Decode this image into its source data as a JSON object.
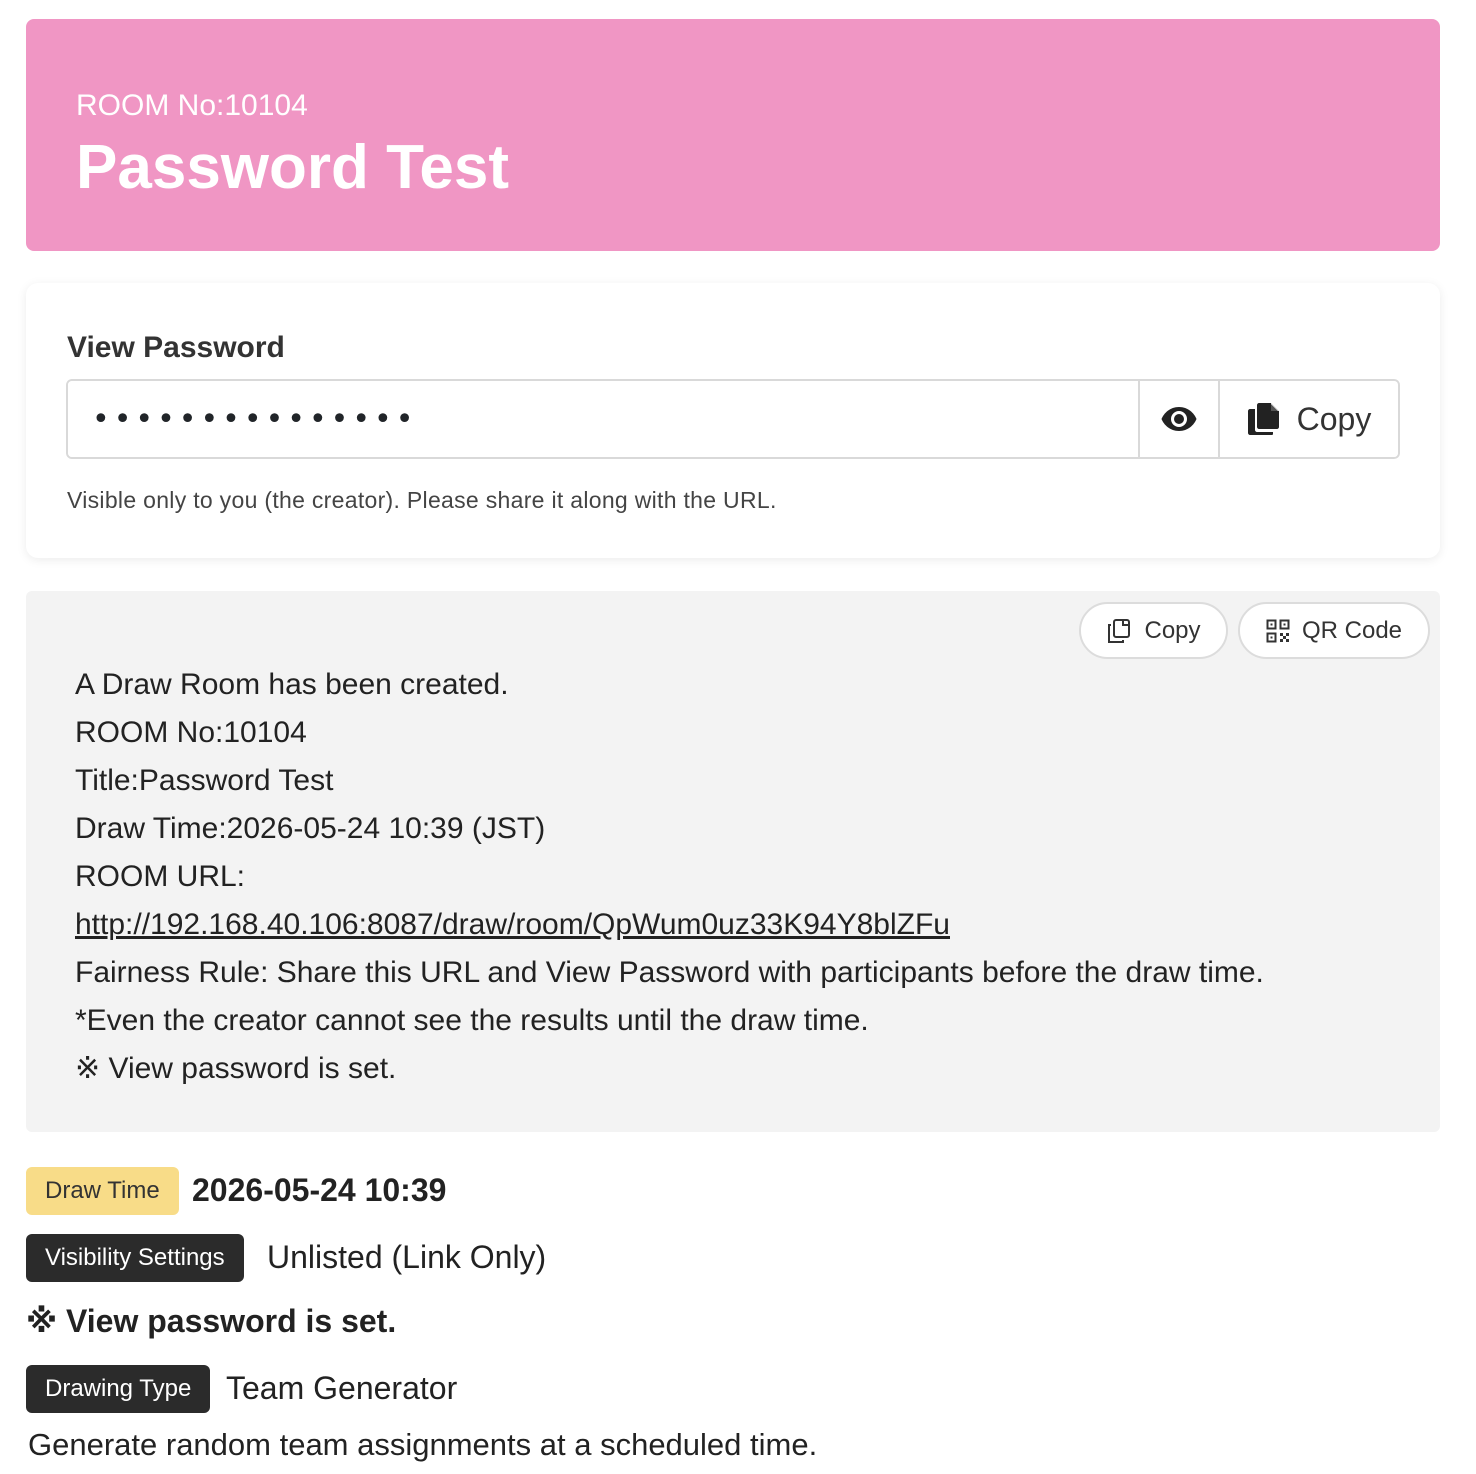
{
  "header": {
    "room_no": "ROOM No:10104",
    "title": "Password Test",
    "color": "#f096c4"
  },
  "password_card": {
    "label": "View Password",
    "value": "•••••••••••••••",
    "toggle_icon": "eye-icon",
    "copy_icon": "copy-icon",
    "copy_label": "Copy",
    "help_text": "Visible only to you (the creator). Please share it along with the URL."
  },
  "summary": {
    "copy_label": "Copy",
    "qr_label": "QR Code",
    "lines": {
      "created": "A Draw Room has been created.",
      "room_no": "ROOM No:10104",
      "title": "Title:Password Test",
      "draw_time": "Draw Time:2026-05-24 10:39 (JST)",
      "url_label": "ROOM URL:",
      "url": "http://192.168.40.106:8087/draw/room/QpWum0uz33K94Y8blZFu",
      "fairness": "Fairness Rule: Share this URL and View Password with participants before the draw time.",
      "note": "*Even the creator cannot see the results until the draw time.",
      "password_note": "※ View password is set."
    }
  },
  "details": {
    "draw_time_badge": "Draw Time",
    "draw_time_value": "2026-05-24 10:39",
    "visibility_badge": "Visibility Settings",
    "visibility_value": "Unlisted (Link Only)",
    "password_note": "※ View password is set.",
    "type_badge": "Drawing Type",
    "type_value": "Team Generator",
    "description": "Generate random team assignments at a scheduled time."
  }
}
